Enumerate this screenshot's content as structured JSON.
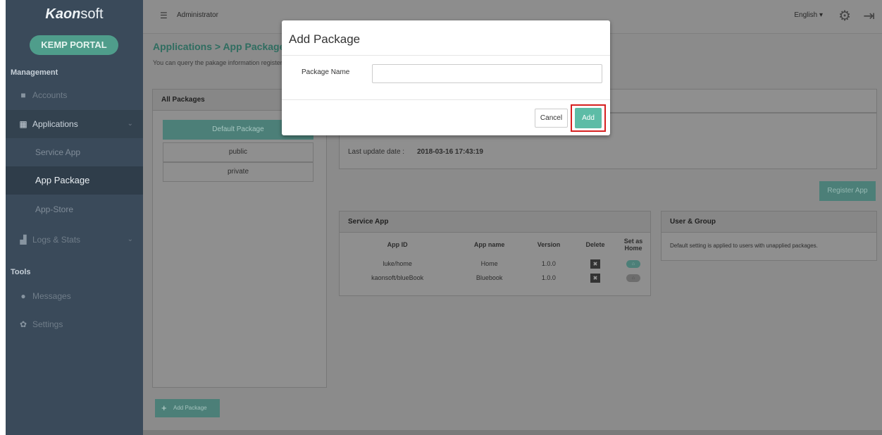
{
  "brand": {
    "logo_bold": "Kaon",
    "logo_light": "soft",
    "portal_label": "KEMP PORTAL"
  },
  "sidebar": {
    "management_label": "Management",
    "tools_label": "Tools",
    "items": [
      {
        "label": "Accounts",
        "icon": "briefcase-icon"
      },
      {
        "label": "Applications",
        "icon": "grid-icon"
      },
      {
        "label": "Service App"
      },
      {
        "label": "App Package"
      },
      {
        "label": "App-Store"
      },
      {
        "label": "Logs & Stats",
        "icon": "bar-chart-icon"
      },
      {
        "label": "Messages",
        "icon": "chat-icon"
      },
      {
        "label": "Settings",
        "icon": "gear-icon"
      }
    ]
  },
  "topbar": {
    "user": "Administrator",
    "language": "English ▾"
  },
  "page": {
    "title": "Applications > App Package",
    "description": "You can query the pakage information registered in the system and manage the applications included in the package and the users and the group."
  },
  "packages": {
    "header": "All Packages",
    "items": [
      "Default Package",
      "public",
      "private"
    ],
    "selected_index": 0,
    "add_button": "Add Package"
  },
  "package_info": {
    "last_update_label": "Last update date :",
    "last_update_value": "2018-03-16 17:43:19"
  },
  "register_button": "Register App",
  "service_app": {
    "header": "Service App",
    "columns": [
      "App ID",
      "App name",
      "Version",
      "Delete",
      "Set as Home"
    ],
    "rows": [
      {
        "app_id": "luke/home",
        "app_name": "Home",
        "version": "1.0.0",
        "is_home": true
      },
      {
        "app_id": "kaonsoft/blueBook",
        "app_name": "Bluebook",
        "version": "1.0.0",
        "is_home": false
      }
    ]
  },
  "user_group": {
    "header": "User & Group",
    "text": "Default setting is applied to users with unapplied packages."
  },
  "modal": {
    "title": "Add Package",
    "label": "Package Name",
    "value": "",
    "placeholder": "",
    "cancel": "Cancel",
    "add": "Add"
  },
  "colors": {
    "accent": "#5dbca6",
    "highlight": "#d62020",
    "sidebar": "#3a4a5a"
  }
}
